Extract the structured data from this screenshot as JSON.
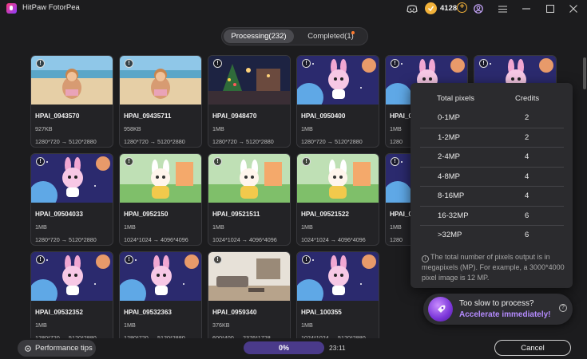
{
  "app": {
    "title": "HitPaw FotorPea"
  },
  "titlebar": {
    "credits": "4128",
    "icons": [
      "discord-icon",
      "coin-icon",
      "add-credits-icon",
      "account-icon",
      "menu-icon",
      "minimize-icon",
      "maximize-icon",
      "close-icon"
    ]
  },
  "tabs": {
    "processing": "Processing(232)",
    "completed": "Completed(1)",
    "active": "processing"
  },
  "items": [
    {
      "name": "HPAI_0943570",
      "size": "927KB",
      "res": "1280*720 → 5120*2880",
      "thumb": "beach"
    },
    {
      "name": "HPAI_09435711",
      "size": "958KB",
      "res": "1280*720 → 5120*2880",
      "thumb": "beach"
    },
    {
      "name": "HPAI_0948470",
      "size": "1MB",
      "res": "1280*720 → 5120*2880",
      "thumb": "xmas"
    },
    {
      "name": "HPAI_0950400",
      "size": "1MB",
      "res": "1280*720 → 5120*2880",
      "thumb": "space"
    },
    {
      "name": "HPAI_0",
      "size": "1MB",
      "res": "1280",
      "thumb": "space"
    },
    {
      "name": "",
      "size": "",
      "res": "",
      "thumb": "space"
    },
    {
      "name": "HPAI_09504033",
      "size": "1MB",
      "res": "1280*720 → 5120*2880",
      "thumb": "space"
    },
    {
      "name": "HPAI_0952150",
      "size": "1MB",
      "res": "1024*1024 → 4096*4096",
      "thumb": "plush"
    },
    {
      "name": "HPAI_09521511",
      "size": "1MB",
      "res": "1024*1024 → 4096*4096",
      "thumb": "plush"
    },
    {
      "name": "HPAI_09521522",
      "size": "1MB",
      "res": "1024*1024 → 4096*4096",
      "thumb": "plush"
    },
    {
      "name": "HPAI_0",
      "size": "1MB",
      "res": "1280",
      "thumb": "space"
    },
    {
      "name": "HPAI_09532341",
      "size": "1MB",
      "res": "1280*720 → 5120*2880",
      "thumb": "space"
    },
    {
      "name": "HPAI_09532352",
      "size": "1MB",
      "res": "1280*720 → 5120*2880",
      "thumb": "space"
    },
    {
      "name": "HPAI_09532363",
      "size": "1MB",
      "res": "1280*720 → 5120*2880",
      "thumb": "space"
    },
    {
      "name": "HPAI_0959340",
      "size": "376KB",
      "res": "600*400 → 2376*1728",
      "thumb": "room"
    },
    {
      "name": "HPAI_100355",
      "size": "1MB",
      "res": "1024*1024 → 5120*2880",
      "thumb": "space"
    }
  ],
  "credits_popup": {
    "col_pixels": "Total pixels",
    "col_credits": "Credits",
    "rows": [
      {
        "pixels": "0-1MP",
        "credits": "2"
      },
      {
        "pixels": "1-2MP",
        "credits": "2"
      },
      {
        "pixels": "2-4MP",
        "credits": "4"
      },
      {
        "pixels": "4-8MP",
        "credits": "4"
      },
      {
        "pixels": "8-16MP",
        "credits": "4"
      },
      {
        "pixels": "16-32MP",
        "credits": "6"
      },
      {
        "pixels": ">32MP",
        "credits": "6"
      }
    ],
    "note": "The total number of pixels output is in megapixels (MP). For example, a 3000*4000 pixel image is 12 MP."
  },
  "toast": {
    "line1": "Too slow to process?",
    "line2": "Accelerate immediately!"
  },
  "footer": {
    "perf_tips": "Performance tips",
    "progress_label": "0%",
    "progress_value": 0,
    "timer": "23:11",
    "cancel": "Cancel"
  },
  "colors": {
    "accent": "#8e6cf0",
    "coin": "#f2b23a",
    "toast_link": "#b58bff",
    "badge_dot": "#ff7a2e"
  }
}
